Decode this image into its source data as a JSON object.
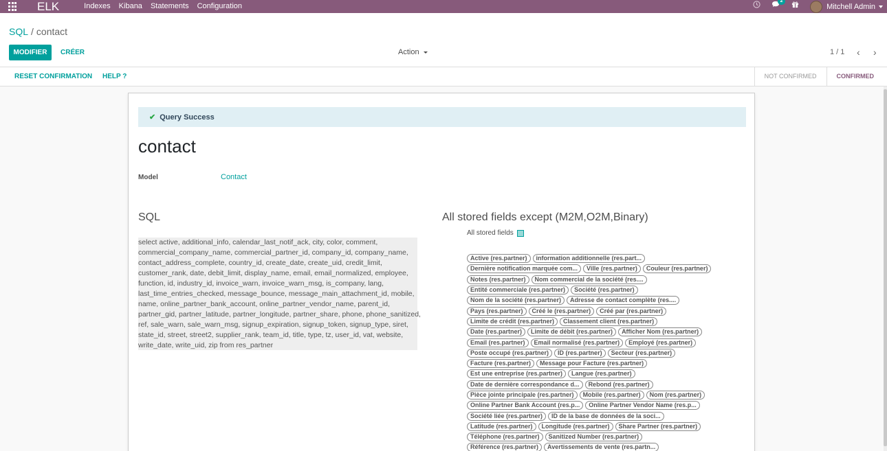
{
  "navbar": {
    "brand": "ELK",
    "menu": [
      "Indexes",
      "Kibana",
      "Statements",
      "Configuration"
    ],
    "messages_count": "2",
    "user_name": "Mitchell Admin"
  },
  "breadcrumb": {
    "parent": "SQL",
    "separator": "/",
    "current": "contact"
  },
  "buttons": {
    "edit": "MODIFIER",
    "create": "CRÉER",
    "action": "Action"
  },
  "pager": {
    "value": "1 / 1",
    "prev": "‹",
    "next": "›"
  },
  "statusbar": {
    "reset": "RESET CONFIRMATION",
    "help": "HELP ?",
    "stages": [
      "NOT CONFIRMED",
      "CONFIRMED"
    ],
    "active_stage": "CONFIRMED"
  },
  "alert": {
    "text": "Query Success"
  },
  "record": {
    "title": "contact",
    "model_label": "Model",
    "model_value": "Contact"
  },
  "sql": {
    "title": "SQL",
    "lines": [
      "select active, additional_info, calendar_last_notif_ack, city, color, comment,",
      "commercial_company_name, commercial_partner_id, company_id, company_name,",
      "contact_address_complete, country_id, create_date, create_uid, credit_limit,",
      "customer_rank, date, debit_limit, display_name, email, email_normalized, employee,",
      "function, id, industry_id, invoice_warn, invoice_warn_msg, is_company, lang,",
      "last_time_entries_checked, message_bounce, message_main_attachment_id, mobile,",
      "name, online_partner_bank_account, online_partner_vendor_name, parent_id,",
      "partner_gid, partner_latitude, partner_longitude, partner_share, phone, phone_sanitized,",
      "ref, sale_warn, sale_warn_msg, signup_expiration, signup_token, signup_type, siret,",
      "state_id, street, street2, supplier_rank, team_id, title, type, tz, user_id, vat, website,",
      "write_date, write_uid, zip from res_partner"
    ]
  },
  "fields": {
    "title": "All stored fields except (M2M,O2M,Binary)",
    "toggle_label": "All stored fields",
    "rows": [
      [
        "Active (res.partner)",
        "information additionnelle (res.part..."
      ],
      [
        "Dernière notification marquée com...",
        "Ville (res.partner)",
        "Couleur (res.partner)"
      ],
      [
        "Notes (res.partner)",
        "Nom commercial de la société (res...."
      ],
      [
        "Entité commerciale (res.partner)",
        "Société (res.partner)"
      ],
      [
        "Nom de la société (res.partner)",
        "Adresse de contact complète (res...."
      ],
      [
        "Pays (res.partner)",
        "Créé le (res.partner)",
        "Créé par (res.partner)"
      ],
      [
        "Limite de crédit (res.partner)",
        "Classement client (res.partner)"
      ],
      [
        "Date (res.partner)",
        "Limite de débit (res.partner)",
        "Afficher Nom (res.partner)"
      ],
      [
        "Email (res.partner)",
        "Email normalisé (res.partner)",
        "Employé (res.partner)"
      ],
      [
        "Poste occupé (res.partner)",
        "ID (res.partner)",
        "Secteur (res.partner)"
      ],
      [
        "Facture (res.partner)",
        "Message pour Facture (res.partner)"
      ],
      [
        "Est une entreprise (res.partner)",
        "Langue (res.partner)"
      ],
      [
        "Date de dernière correspondance d...",
        "Rebond (res.partner)"
      ],
      [
        "Pièce jointe principale (res.partner)",
        "Mobile (res.partner)",
        "Nom (res.partner)"
      ],
      [
        "Online Partner Bank Account (res.p...",
        "Online Partner Vendor Name (res.p..."
      ],
      [
        "Société liée (res.partner)",
        "ID de la base de données de la soci..."
      ],
      [
        "Latitude (res.partner)",
        "Longitude (res.partner)",
        "Share Partner (res.partner)"
      ],
      [
        "Téléphone (res.partner)",
        "Sanitized Number (res.partner)"
      ],
      [
        "Référence (res.partner)",
        "Avertissements de vente (res.partn..."
      ]
    ]
  }
}
